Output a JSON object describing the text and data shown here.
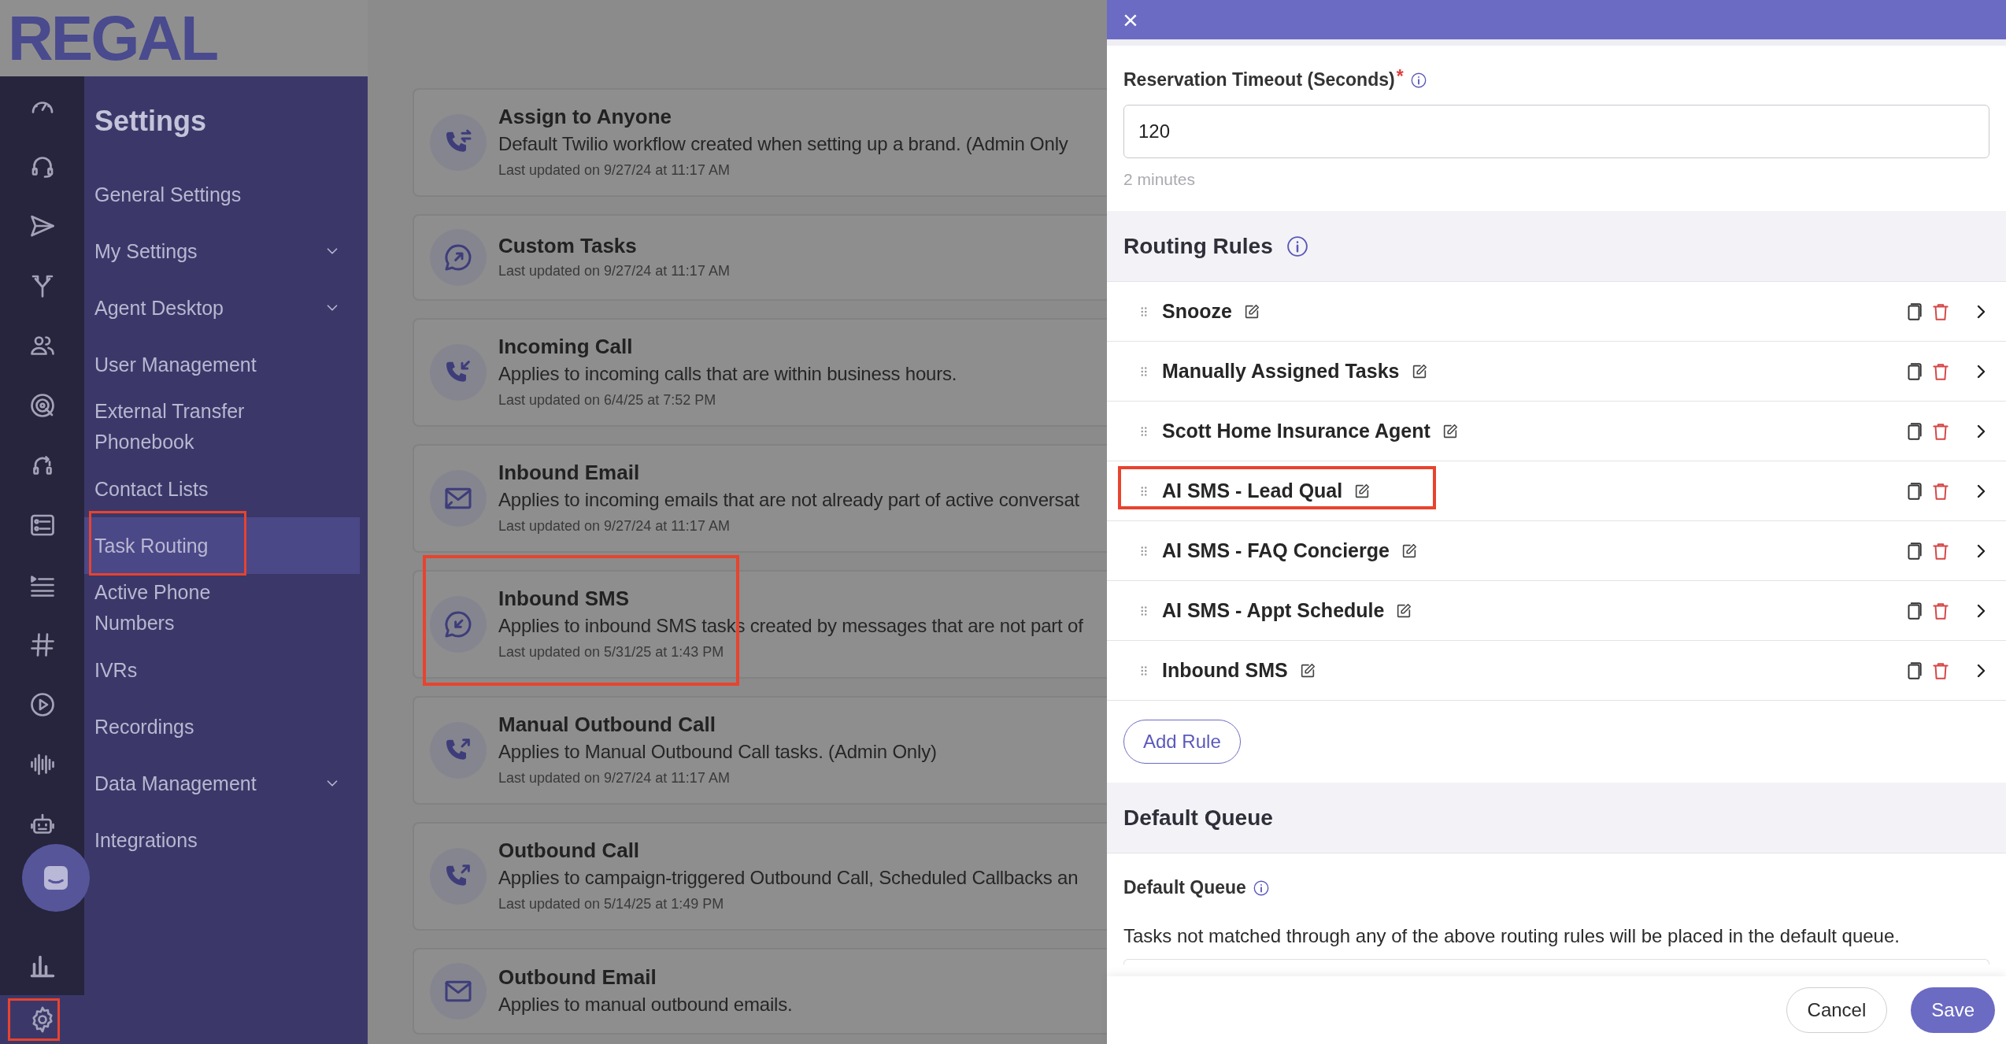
{
  "logo": {
    "text": "REGAL"
  },
  "rail_items": [
    {
      "kind": "gauge",
      "highlighted": false
    },
    {
      "kind": "headset",
      "highlighted": false
    },
    {
      "kind": "send",
      "highlighted": false
    },
    {
      "kind": "fork",
      "highlighted": false
    },
    {
      "kind": "people",
      "highlighted": false
    },
    {
      "kind": "target",
      "highlighted": false
    },
    {
      "kind": "headset-cycle",
      "highlighted": false
    },
    {
      "kind": "form",
      "highlighted": false
    },
    {
      "kind": "list",
      "highlighted": false
    },
    {
      "kind": "hash",
      "highlighted": false
    },
    {
      "kind": "play",
      "highlighted": false
    },
    {
      "kind": "wave",
      "highlighted": false
    },
    {
      "kind": "robot",
      "highlighted": false
    },
    {
      "kind": "chart",
      "highlighted": false
    },
    {
      "kind": "gear",
      "highlighted": true
    }
  ],
  "settings_nav": {
    "title": "Settings",
    "items": [
      {
        "label": "General Settings",
        "expandable": false,
        "selected": false,
        "highlighted": false
      },
      {
        "label": "My Settings",
        "expandable": true,
        "selected": false,
        "highlighted": false
      },
      {
        "label": "Agent Desktop",
        "expandable": true,
        "selected": false,
        "highlighted": false
      },
      {
        "label": "User Management",
        "expandable": false,
        "selected": false,
        "highlighted": false
      },
      {
        "label": "External Transfer Phonebook",
        "expandable": false,
        "selected": false,
        "highlighted": false
      },
      {
        "label": "Contact Lists",
        "expandable": false,
        "selected": false,
        "highlighted": false
      },
      {
        "label": "Task Routing",
        "expandable": false,
        "selected": true,
        "highlighted": true
      },
      {
        "label": "Active Phone Numbers",
        "expandable": false,
        "selected": false,
        "highlighted": false
      },
      {
        "label": "IVRs",
        "expandable": false,
        "selected": false,
        "highlighted": false
      },
      {
        "label": "Recordings",
        "expandable": false,
        "selected": false,
        "highlighted": false
      },
      {
        "label": "Data Management",
        "expandable": true,
        "selected": false,
        "highlighted": false
      },
      {
        "label": "Integrations",
        "expandable": false,
        "selected": false,
        "highlighted": false
      }
    ]
  },
  "workflows": [
    {
      "kind": "phone-transfer",
      "title": "Assign to Anyone",
      "description": "Default Twilio workflow created when setting up a brand. (Admin Only",
      "updated": "Last updated on 9/27/24 at 11:17 AM",
      "highlighted": false
    },
    {
      "kind": "chat-out",
      "title": "Custom Tasks",
      "updated": "Last updated on 9/27/24 at 11:17 AM",
      "highlighted": false
    },
    {
      "kind": "phone-in",
      "title": "Incoming Call",
      "description": "Applies to incoming calls that are within business hours.",
      "updated": "Last updated on 6/4/25 at 7:52 PM",
      "highlighted": false
    },
    {
      "kind": "mail-in",
      "title": "Inbound Email",
      "description": "Applies to incoming emails that are not already part of active conversat",
      "updated": "Last updated on 9/27/24 at 11:17 AM",
      "highlighted": false
    },
    {
      "kind": "chat-in",
      "title": "Inbound SMS",
      "description": "Applies to inbound SMS tasks created by messages that are not part of",
      "updated": "Last updated on 5/31/25 at 1:43 PM",
      "highlighted": true
    },
    {
      "kind": "phone-out",
      "title": "Manual Outbound Call",
      "description": "Applies to Manual Outbound Call tasks. (Admin Only)",
      "updated": "Last updated on 9/27/24 at 11:17 AM",
      "highlighted": false
    },
    {
      "kind": "phone-out",
      "title": "Outbound Call",
      "description": "Applies to campaign-triggered Outbound Call, Scheduled Callbacks an",
      "updated": "Last updated on 5/14/25 at 1:49 PM",
      "highlighted": false
    },
    {
      "kind": "mail",
      "title": "Outbound Email",
      "description": "Applies to manual outbound emails.",
      "highlighted": false
    }
  ],
  "panel": {
    "close": "×",
    "timeout": {
      "label": "Reservation Timeout (Seconds)",
      "required": "*",
      "value": "120",
      "hint": "2 minutes"
    },
    "routing_rules": {
      "title": "Routing Rules",
      "rules": [
        {
          "name": "Snooze",
          "highlighted": false
        },
        {
          "name": "Manually Assigned Tasks",
          "highlighted": false
        },
        {
          "name": "Scott Home Insurance Agent",
          "highlighted": false
        },
        {
          "name": "AI SMS - Lead Qual",
          "highlighted": true
        },
        {
          "name": "AI SMS - FAQ Concierge",
          "highlighted": false
        },
        {
          "name": "AI SMS - Appt Schedule",
          "highlighted": false
        },
        {
          "name": "Inbound SMS",
          "highlighted": false
        }
      ],
      "add_button": "Add Rule"
    },
    "default_queue": {
      "title": "Default Queue",
      "label": "Default Queue",
      "description": "Tasks not matched through any of the above routing rules will be placed in the default queue."
    },
    "buttons": {
      "cancel": "Cancel",
      "save": "Save"
    }
  }
}
